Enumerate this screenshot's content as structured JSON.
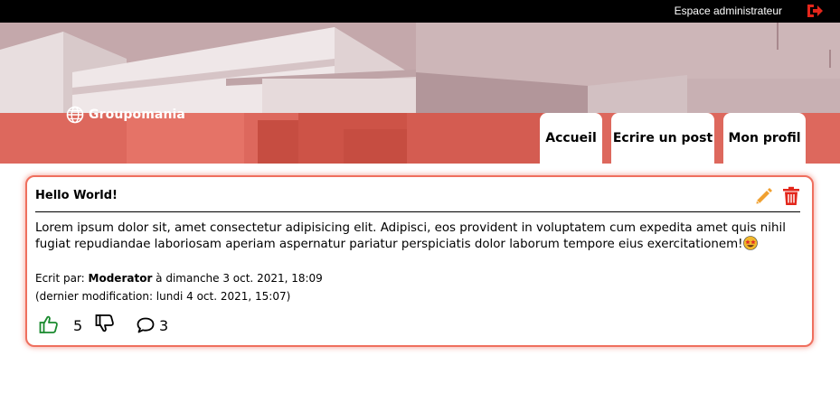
{
  "admin_bar": {
    "admin_label": "Espace administrateur",
    "logout_icon": "sign-out-icon",
    "logout_color": "#e3261b"
  },
  "header": {
    "logo_text": "Groupomania",
    "logo_icon": "globe-icon",
    "band_color": "#e45646",
    "nav": {
      "home": "Accueil",
      "write": "Ecrire un post",
      "profile": "Mon profil"
    }
  },
  "post": {
    "title": "Hello World!",
    "body": "Lorem ipsum dolor sit, amet consectetur adipisicing elit. Adipisci, eos provident in voluptatem cum expedita amet quis nihil fugiat repudiandae laboriosam aperiam aspernatur pariatur perspiciatis dolor laborum tempore eius exercitationem!",
    "emoji": "star-struck-emoji",
    "written_prefix": "Ecrit par: ",
    "author": "Moderator",
    "written_date": " à dimanche 3 oct. 2021, 18:09",
    "modified": "(dernier modification: lundi 4 oct. 2021, 15:07)",
    "likes": "5",
    "comments": "3",
    "edit_icon": "pencil-icon",
    "delete_icon": "trash-icon",
    "like_icon": "thumbs-up-icon",
    "dislike_icon": "thumbs-down-icon",
    "comment_icon": "speech-bubble-icon",
    "colors": {
      "border": "#ef6f5e",
      "edit": "#f0a030",
      "delete": "#e3261b",
      "like": "#1a8a2e"
    }
  }
}
